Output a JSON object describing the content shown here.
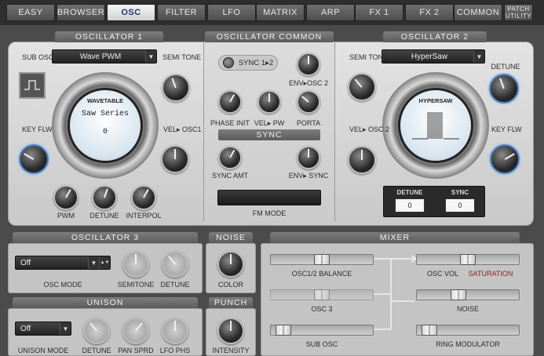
{
  "tabs": [
    {
      "label": "EASY"
    },
    {
      "label": "BROWSER"
    },
    {
      "label": "OSC"
    },
    {
      "label": "FILTER"
    },
    {
      "label": "LFO"
    },
    {
      "label": "MATRIX"
    },
    {
      "label": "ARP"
    },
    {
      "label": "FX 1"
    },
    {
      "label": "FX 2"
    },
    {
      "label": "COMMON"
    },
    {
      "label": "PATCH UTILITY"
    }
  ],
  "osc1": {
    "title": "OSCILLATOR 1",
    "wave_select": "Wave PWM",
    "sub_osc_label": "SUB OSC",
    "semitone_label": "SEMI TONE",
    "key_flw_label": "KEY FLW",
    "vel_osc1_label": "VEL▸ OSC1",
    "wavetable_label": "WAVETABLE",
    "wavetable_name": "Saw Series",
    "wavetable_pos": "0",
    "pwm_label": "PWM",
    "detune_label": "DETUNE",
    "interpol_label": "INTERPOL"
  },
  "common": {
    "title": "OSCILLATOR COMMON",
    "sync_label": "SYNC 1▸2",
    "env_osc2_label": "ENV▸OSC 2",
    "phase_init_label": "PHASE INIT",
    "vel_pw_label": "VEL▸ PW",
    "porta_label": "PORTA",
    "sync_header": "SYNC",
    "sync_amt_label": "SYNC AMT",
    "env_sync_label": "ENV▸ SYNC",
    "fm_mode_label": "FM MODE"
  },
  "osc2": {
    "title": "OSCILLATOR 2",
    "wave_select": "HyperSaw",
    "semitone_label": "SEMI TONE",
    "detune_label": "DETUNE",
    "vel_osc2_label": "VEL▸ OSC 2",
    "key_flw_label": "KEY FLW",
    "screen_label": "HYPERSAW",
    "detune_box_label": "DETUNE",
    "detune_box_value": "0",
    "sync_box_label": "SYNC",
    "sync_box_value": "0"
  },
  "osc3": {
    "title": "OSCILLATOR 3",
    "mode_value": "Off",
    "mode_label": "OSC MODE",
    "semitone_label": "SEMITONE",
    "detune_label": "DETUNE"
  },
  "noise": {
    "title": "NOISE",
    "color_label": "COLOR"
  },
  "unison": {
    "title": "UNISON",
    "mode_value": "Off",
    "mode_label": "UNISON MODE",
    "detune_label": "DETUNE",
    "pan_sprd_label": "PAN SPRD",
    "lfo_phs_label": "LFO PHS"
  },
  "punch": {
    "title": "PUNCH",
    "intensity_label": "INTENSITY"
  },
  "mixer": {
    "title": "MIXER",
    "osc12_balance_label": "OSC1/2 BALANCE",
    "osc12_balance_value": 0.5,
    "osc3_label": "OSC 3",
    "osc3_value": 0.5,
    "sub_osc_label": "SUB OSC",
    "sub_osc_value": 0.05,
    "osc_vol_label": "OSC VOL",
    "saturation_label": "SATURATION",
    "osc_vol_value": 0.5,
    "noise_label": "NOISE",
    "noise_value": 0.39,
    "ring_mod_label": "RING MODULATOR",
    "ring_mod_value": 0.05
  }
}
